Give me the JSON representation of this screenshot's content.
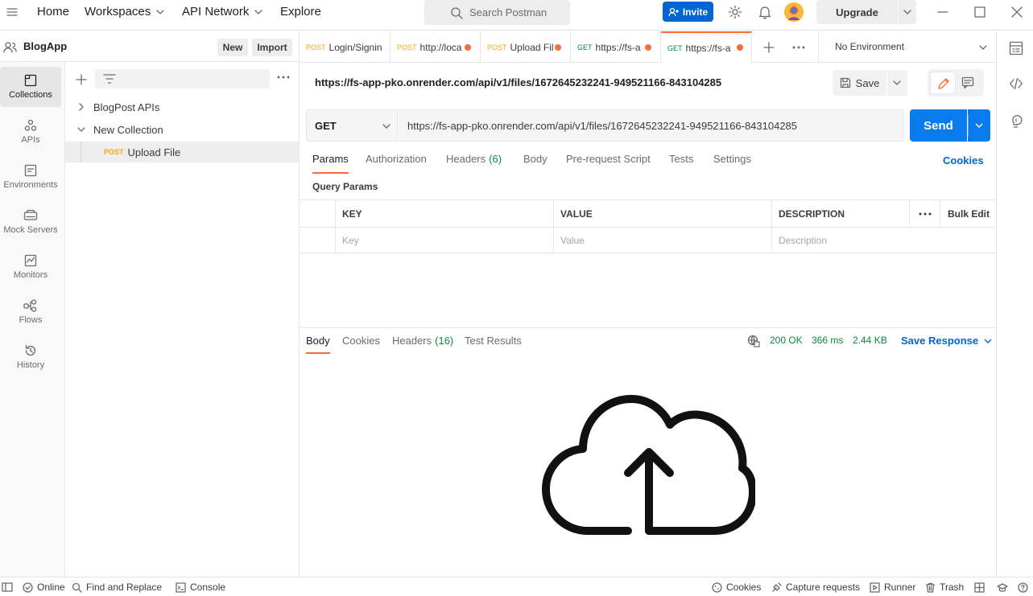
{
  "header": {
    "nav": [
      "Home",
      "Workspaces",
      "API Network",
      "Explore"
    ],
    "search_placeholder": "Search Postman",
    "invite_label": "Invite",
    "upgrade_label": "Upgrade"
  },
  "workspace": {
    "name": "BlogApp",
    "new_label": "New",
    "import_label": "Import"
  },
  "rail": [
    "Collections",
    "APIs",
    "Environments",
    "Mock Servers",
    "Monitors",
    "Flows",
    "History"
  ],
  "tree": {
    "collection1": "BlogPost APIs",
    "collection2": "New Collection",
    "request_method": "POST",
    "request_name": "Upload File"
  },
  "tabs": [
    {
      "method": "POST",
      "title": "Login/Signin"
    },
    {
      "method": "POST",
      "title": "http://loca"
    },
    {
      "method": "POST",
      "title": "Upload Fil"
    },
    {
      "method": "GET",
      "title": "https://fs-a"
    },
    {
      "method": "GET",
      "title": "https://fs-a"
    }
  ],
  "environment": "No Environment",
  "request": {
    "title_url": "https://fs-app-pko.onrender.com/api/v1/files/1672645232241-949521166-843104285",
    "save_label": "Save",
    "method": "GET",
    "url": "https://fs-app-pko.onrender.com/api/v1/files/1672645232241-949521166-843104285",
    "send_label": "Send"
  },
  "req_tabs": {
    "params": "Params",
    "authorization": "Authorization",
    "headers": "Headers",
    "headers_count": "(6)",
    "body": "Body",
    "prerequest": "Pre-request Script",
    "tests": "Tests",
    "settings": "Settings",
    "cookies": "Cookies"
  },
  "query_params": {
    "title": "Query Params",
    "col_key": "KEY",
    "col_value": "VALUE",
    "col_description": "DESCRIPTION",
    "bulk_edit": "Bulk Edit",
    "ph_key": "Key",
    "ph_value": "Value",
    "ph_description": "Description"
  },
  "response": {
    "tab_body": "Body",
    "tab_cookies": "Cookies",
    "tab_headers": "Headers",
    "headers_count": "(16)",
    "tab_tests": "Test Results",
    "status": "200 OK",
    "time": "366 ms",
    "size": "2.44 KB",
    "save_response": "Save Response",
    "preview_icon": "cloud-upload-icon"
  },
  "statusbar": {
    "online": "Online",
    "find_replace": "Find and Replace",
    "console": "Console",
    "cookies": "Cookies",
    "capture": "Capture requests",
    "runner": "Runner",
    "trash": "Trash"
  },
  "colors": {
    "accent": "#ff6c37",
    "send_blue": "#097bed",
    "post": "#ffa500",
    "get": "#0b8a3e",
    "link_blue": "#0265d2"
  }
}
